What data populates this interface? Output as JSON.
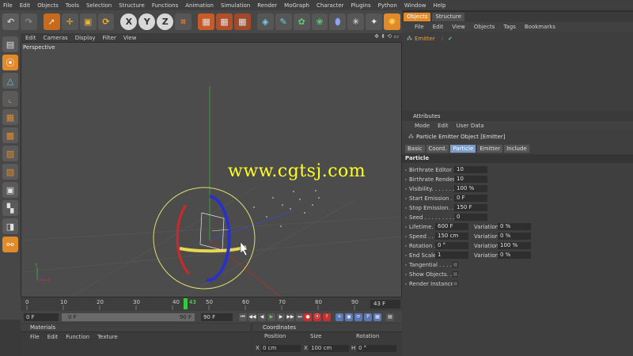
{
  "menu": [
    "File",
    "Edit",
    "Objects",
    "Tools",
    "Selection",
    "Structure",
    "Functions",
    "Animation",
    "Simulation",
    "Render",
    "MoGraph",
    "Character",
    "Plugins",
    "Python",
    "Window",
    "Help"
  ],
  "toolbar": {
    "x": "X",
    "y": "Y",
    "z": "Z"
  },
  "viewport": {
    "menu": [
      "Edit",
      "Cameras",
      "Display",
      "Filter",
      "View"
    ],
    "label": "Perspective",
    "watermark": "www.cgtsj.com"
  },
  "timeline": {
    "ticks": [
      "0",
      "10",
      "20",
      "30",
      "40",
      "43",
      "50",
      "60",
      "70",
      "80",
      "90"
    ],
    "current_frame": "43 F",
    "start_field": "0 F",
    "range_start": "0 F",
    "range_end": "90 F",
    "end_field": "90 F"
  },
  "materials": {
    "title": "Materials",
    "menu": [
      "File",
      "Edit",
      "Function",
      "Texture"
    ]
  },
  "coordinates": {
    "title": "Coordinates",
    "headers": [
      "Position",
      "Size",
      "Rotation"
    ],
    "row": [
      {
        "axis": "X",
        "value": "0 cm"
      },
      {
        "axis": "X",
        "value": "100 cm"
      },
      {
        "axis": "H",
        "value": "0 °"
      }
    ]
  },
  "objects_panel": {
    "tabs": [
      "Objects",
      "Structure"
    ],
    "menu": [
      "File",
      "Edit",
      "View",
      "Objects",
      "Tags",
      "Bookmarks"
    ],
    "items": [
      {
        "name": "Emitter"
      }
    ]
  },
  "attributes": {
    "title": "Attributes",
    "menu": [
      "Mode",
      "Edit",
      "User Data"
    ],
    "object_title": "Particle Emitter Object [Emitter]",
    "tabs": [
      "Basic",
      "Coord.",
      "Particle",
      "Emitter",
      "Include"
    ],
    "active_tab": "Particle",
    "section": "Particle",
    "rows": [
      {
        "label": "Birthrate Editor . . .",
        "value": "10"
      },
      {
        "label": "Birthrate Renderer",
        "value": "10"
      },
      {
        "label": "Visibility. . . . . . . .",
        "value": "100 %"
      },
      {
        "label": "Start Emission . . .",
        "value": "0 F"
      },
      {
        "label": "Stop Emission. . . .",
        "value": "150 F"
      },
      {
        "label": "Seed . . . . . . . . .",
        "value": "0"
      }
    ],
    "var_rows": [
      {
        "label": "Lifetime. . . .",
        "value": "600 F",
        "vlabel": "Variation",
        "vvalue": "0 %"
      },
      {
        "label": "Speed . . . . .",
        "value": "150 cm",
        "vlabel": "Variation",
        "vvalue": "0 %"
      },
      {
        "label": "Rotation . . .",
        "value": "0 °",
        "vlabel": "Variation",
        "vvalue": "100 %"
      },
      {
        "label": "End Scale . .",
        "value": "1",
        "vlabel": "Variation",
        "vvalue": "0 %"
      }
    ],
    "checks": [
      {
        "label": "Tangential . . . . ."
      },
      {
        "label": "Show Objects. . . ."
      },
      {
        "label": "Render Instances"
      }
    ]
  }
}
